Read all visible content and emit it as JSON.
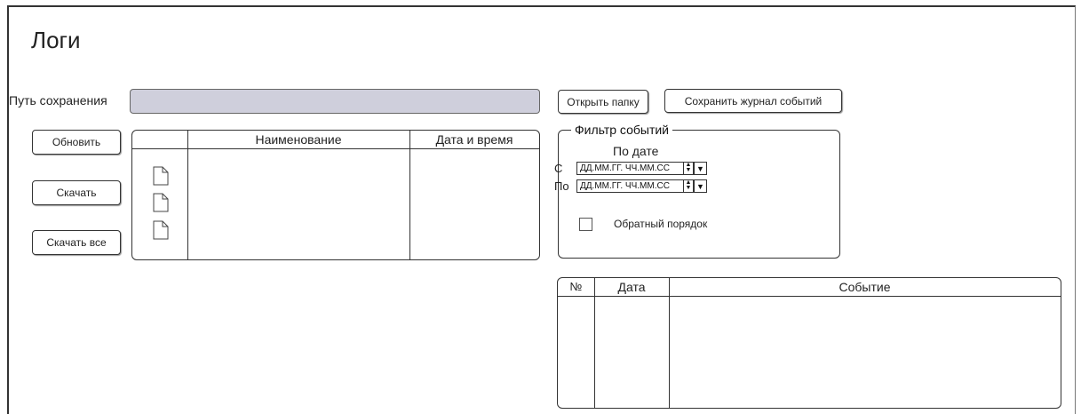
{
  "page": {
    "title": "Логи"
  },
  "save_path": {
    "label": "Путь сохранения",
    "value": ""
  },
  "buttons": {
    "open_folder": "Открыть папку",
    "save_log": "Сохранить журнал событий",
    "refresh": "Обновить",
    "download": "Скачать",
    "download_all": "Скачать все"
  },
  "files_table": {
    "columns": [
      "",
      "Наименование",
      "Дата и время"
    ],
    "rows": [
      {
        "icon": "file-icon",
        "name": "",
        "datetime": ""
      },
      {
        "icon": "file-icon",
        "name": "",
        "datetime": ""
      },
      {
        "icon": "file-icon",
        "name": "",
        "datetime": ""
      }
    ]
  },
  "filter": {
    "legend": "Фильтр событий",
    "by_date": "По дате",
    "from_label": "С",
    "to_label": "По",
    "from_value": "ДД.ММ.ГГ. ЧЧ.ММ.СС",
    "to_value": "ДД.ММ.ГГ. ЧЧ.ММ.СС",
    "reverse_label": "Обратный порядок",
    "reverse_checked": false
  },
  "events_table": {
    "columns": [
      "№",
      "Дата",
      "Событие"
    ],
    "rows": []
  }
}
